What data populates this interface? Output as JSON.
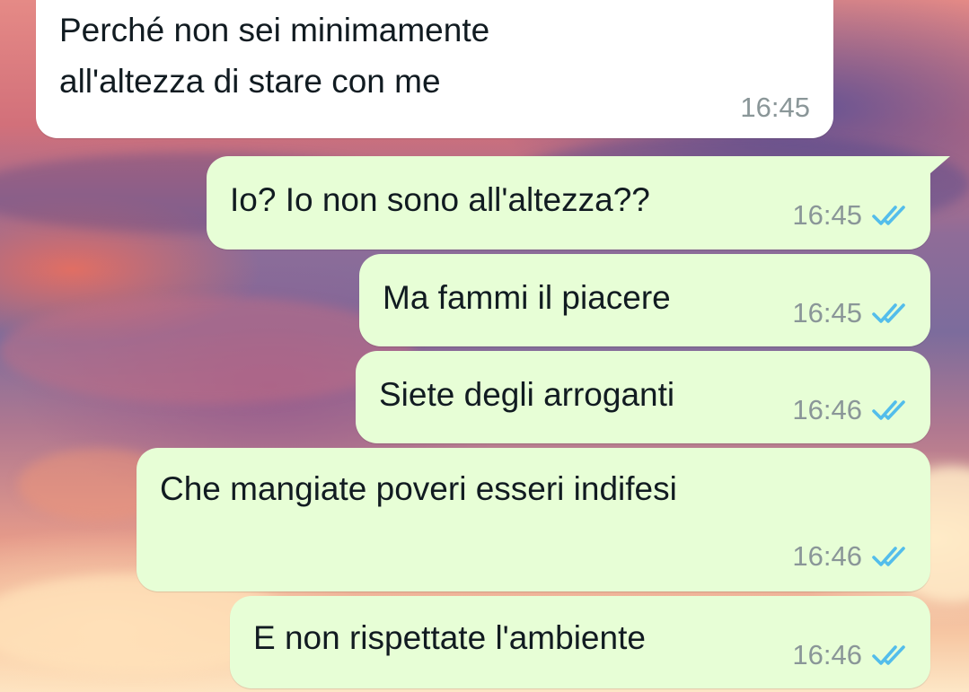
{
  "conversation": {
    "messages": [
      {
        "text_lines": [
          "Perché non sei minimamente",
          "all'altezza di stare con me"
        ],
        "time": "16:45",
        "direction": "incoming"
      },
      {
        "text": "Io? Io non sono all'altezza??",
        "time": "16:45",
        "direction": "outgoing",
        "status": "read"
      },
      {
        "text": "Ma fammi il piacere",
        "time": "16:45",
        "direction": "outgoing",
        "status": "read"
      },
      {
        "text": "Siete degli arroganti",
        "time": "16:46",
        "direction": "outgoing",
        "status": "read"
      },
      {
        "text": "Che mangiate poveri esseri indifesi",
        "time": "16:46",
        "direction": "outgoing",
        "status": "read"
      },
      {
        "text": "E non rispettate l'ambiente",
        "time": "16:46",
        "direction": "outgoing",
        "status": "read"
      }
    ]
  },
  "theme": {
    "incoming_bubble_color": "#ffffff",
    "outgoing_bubble_color": "#e7fed6",
    "read_tick_color": "#53bdeb",
    "timestamp_color": "#8a9698",
    "icons": {
      "read_receipt": "double-check-icon"
    }
  }
}
